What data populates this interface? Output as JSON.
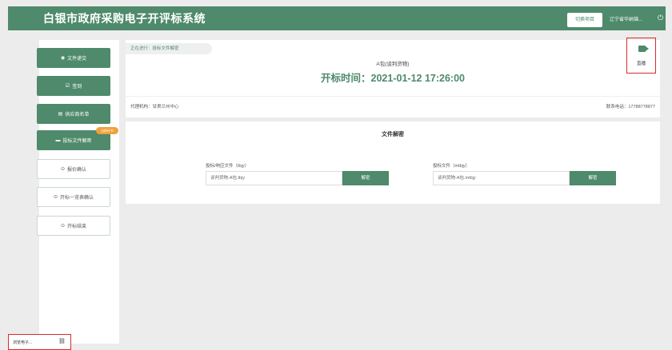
{
  "header": {
    "title": "白银市政府采购电子开评标系统",
    "switch_label": "切换项目",
    "user": "辽宁省华纳锦...",
    "power_icon": "power-icon"
  },
  "sidebar": {
    "items": [
      {
        "label": "文件递交",
        "icon": "circle-dot-icon",
        "style": "filled"
      },
      {
        "label": "签到",
        "icon": "checkbox-icon",
        "style": "filled"
      },
      {
        "label": "供应商名单",
        "icon": "list-icon",
        "style": "filled"
      },
      {
        "label": "投标文件解密",
        "icon": "folder-icon",
        "style": "filled",
        "badge": "当前环节"
      },
      {
        "label": "报价确认",
        "icon": "check-circle-icon",
        "style": "outline"
      },
      {
        "label": "开标一览表确认",
        "icon": "check-circle-icon",
        "style": "outline"
      },
      {
        "label": "开标结束",
        "icon": "check-circle-icon",
        "style": "outline"
      }
    ]
  },
  "status": {
    "text": "正在进行：投标文件解密"
  },
  "package": {
    "name": "A包(谈判货物)"
  },
  "open_time": {
    "label": "开标时间：",
    "value": "2021-01-12 17:26:00"
  },
  "live": {
    "label": "直播"
  },
  "agency": {
    "text": "代理机构：甘肃兰州中心"
  },
  "phone": {
    "text": "联系电话：17788778877"
  },
  "decrypt": {
    "title": "文件解密",
    "fields": [
      {
        "label": "投标/响应文件（tbjy）",
        "value": "谈判货物-A包.tbjy",
        "button": "解密"
      },
      {
        "label": "投标文件（mtbjy）",
        "value": "谈判货物-A包.mtbjy",
        "button": "解密"
      }
    ]
  },
  "corner": {
    "text": "浏览电子...",
    "icon": "link-icon"
  },
  "colors": {
    "accent": "#4e8a6b",
    "highlight": "#d92b2b",
    "badge": "#f0a03a"
  }
}
